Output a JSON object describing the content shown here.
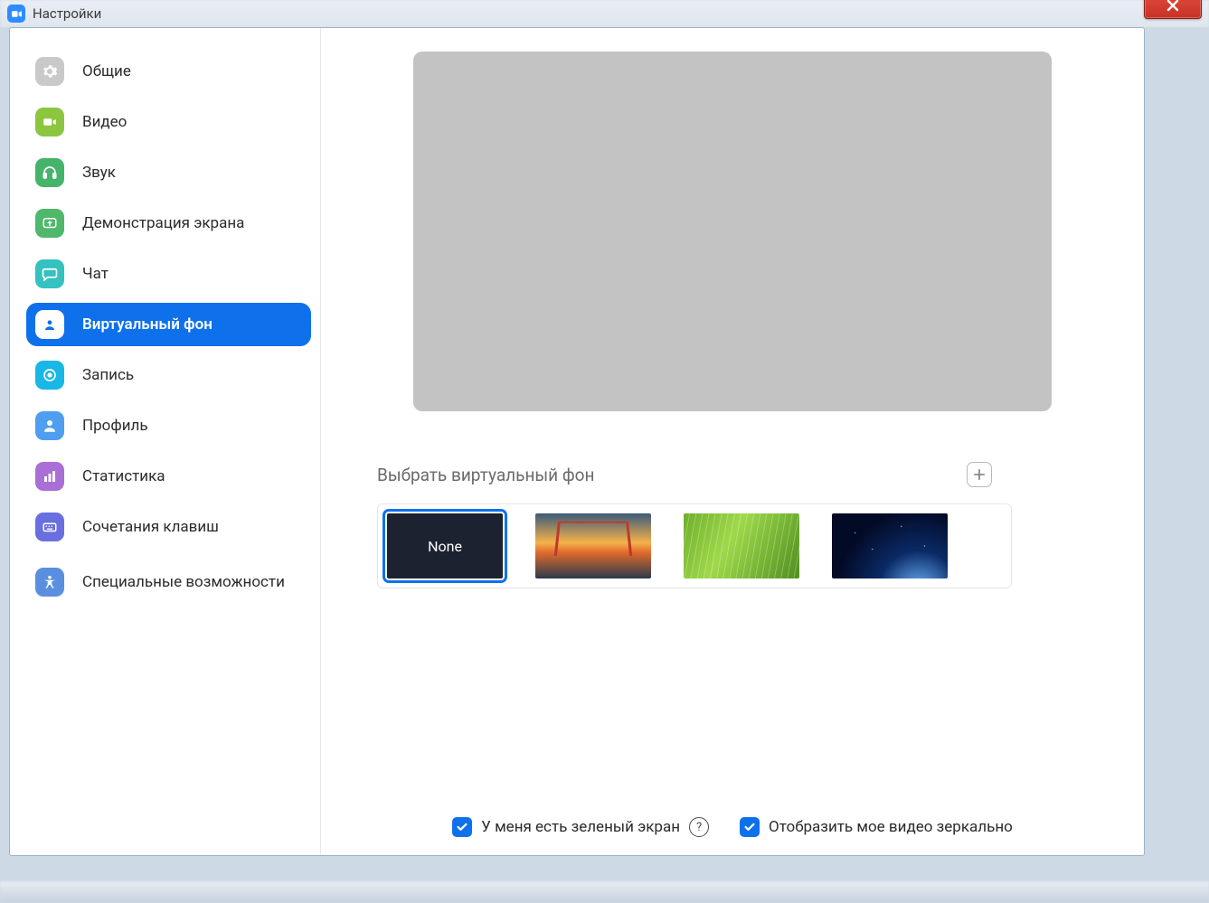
{
  "window": {
    "title": "Настройки"
  },
  "sidebar": {
    "items": [
      {
        "id": "general",
        "label": "Общие",
        "icon": "gear-icon",
        "color": "#c9c9c9"
      },
      {
        "id": "video",
        "label": "Видео",
        "icon": "video-icon",
        "color": "#8cc63f"
      },
      {
        "id": "audio",
        "label": "Звук",
        "icon": "headphones-icon",
        "color": "#46b36a"
      },
      {
        "id": "share",
        "label": "Демонстрация экрана",
        "icon": "share-icon",
        "color": "#4fb86b"
      },
      {
        "id": "chat",
        "label": "Чат",
        "icon": "chat-icon",
        "color": "#34c1bf"
      },
      {
        "id": "vbg",
        "label": "Виртуальный фон",
        "icon": "portrait-icon",
        "color": "#0E71EB",
        "active": true
      },
      {
        "id": "record",
        "label": "Запись",
        "icon": "record-icon",
        "color": "#18b7e6"
      },
      {
        "id": "profile",
        "label": "Профиль",
        "icon": "person-icon",
        "color": "#4f9ef0"
      },
      {
        "id": "stats",
        "label": "Статистика",
        "icon": "stats-icon",
        "color": "#a96fd6"
      },
      {
        "id": "shortcuts",
        "label": "Сочетания клавиш",
        "icon": "keyboard-icon",
        "color": "#6a6fe0"
      },
      {
        "id": "accessibility",
        "label": "Специальные возможности",
        "icon": "accessibility-icon",
        "color": "#5a8fe0"
      }
    ]
  },
  "content": {
    "section_title": "Выбрать виртуальный фон",
    "thumbs": {
      "none_label": "None",
      "selected_index": 0
    }
  },
  "footer": {
    "green_screen_label": "У меня есть зеленый экран",
    "mirror_label": "Отобразить мое видео зеркально",
    "green_screen_checked": true,
    "mirror_checked": true
  },
  "colors": {
    "accent": "#0E71EB"
  }
}
